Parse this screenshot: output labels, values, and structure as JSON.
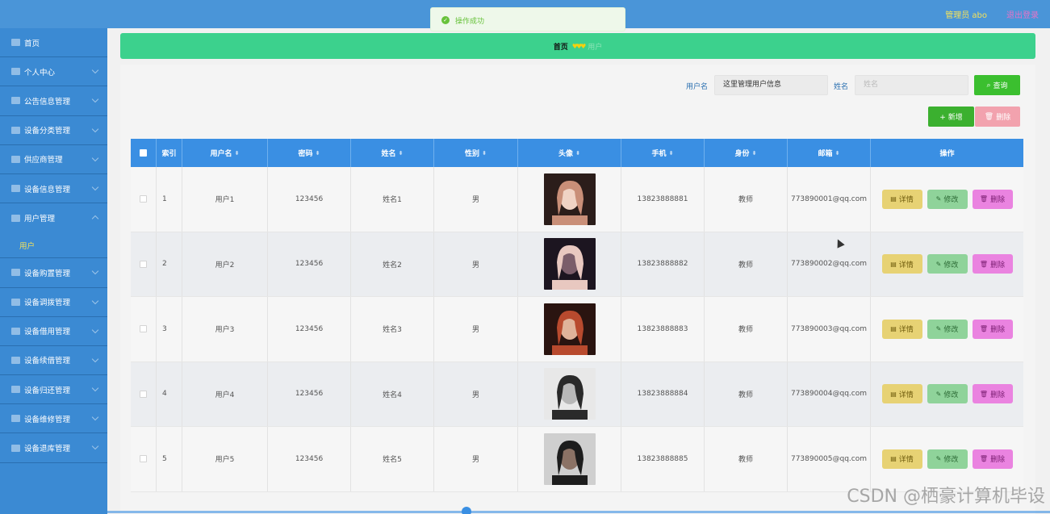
{
  "header": {
    "admin_label": "管理员 abo",
    "logout_label": "退出登录",
    "toast_text": "操作成功",
    "toast_icon": "check-circle-icon"
  },
  "sidebar": {
    "items": [
      {
        "label": "首页",
        "icon": "home-icon"
      },
      {
        "label": "个人中心",
        "icon": "user-icon"
      },
      {
        "label": "公告信息管理",
        "icon": "sliders-icon"
      },
      {
        "label": "设备分类管理",
        "icon": "list-icon"
      },
      {
        "label": "供应商管理",
        "icon": "circle-icon"
      },
      {
        "label": "设备信息管理",
        "icon": "frame-icon"
      },
      {
        "label": "用户管理",
        "icon": "bank-icon",
        "expanded": true,
        "children": [
          "用户"
        ]
      },
      {
        "label": "设备购置管理",
        "icon": "folder-icon"
      },
      {
        "label": "设备调拨管理",
        "icon": "building-icon"
      },
      {
        "label": "设备借用管理",
        "icon": "grid-icon"
      },
      {
        "label": "设备续借管理",
        "icon": "mail-icon"
      },
      {
        "label": "设备归还管理",
        "icon": "chart-icon"
      },
      {
        "label": "设备维修管理",
        "icon": "flag-icon"
      },
      {
        "label": "设备退库管理",
        "icon": "message-icon"
      }
    ]
  },
  "breadcrumb": {
    "home": "首页",
    "current": "用户"
  },
  "search": {
    "username_label": "用户名",
    "username_value": "这里管理用户信息",
    "name_label": "姓名",
    "name_placeholder": "姓名",
    "search_button": "查询",
    "add_button": "+ 新增",
    "delete_button": "删除"
  },
  "table": {
    "columns": [
      "索引",
      "用户名",
      "密码",
      "姓名",
      "性别",
      "头像",
      "手机",
      "身份",
      "邮箱",
      "操作"
    ],
    "rows": [
      {
        "index": "1",
        "username": "用户1",
        "password": "123456",
        "name": "姓名1",
        "gender": "男",
        "phone": "13823888881",
        "role": "教师",
        "email": "773890001@qq.com"
      },
      {
        "index": "2",
        "username": "用户2",
        "password": "123456",
        "name": "姓名2",
        "gender": "男",
        "phone": "13823888882",
        "role": "教师",
        "email": "773890002@qq.com"
      },
      {
        "index": "3",
        "username": "用户3",
        "password": "123456",
        "name": "姓名3",
        "gender": "男",
        "phone": "13823888883",
        "role": "教师",
        "email": "773890003@qq.com"
      },
      {
        "index": "4",
        "username": "用户4",
        "password": "123456",
        "name": "姓名4",
        "gender": "男",
        "phone": "13823888884",
        "role": "教师",
        "email": "773890004@qq.com"
      },
      {
        "index": "5",
        "username": "用户5",
        "password": "123456",
        "name": "姓名5",
        "gender": "男",
        "phone": "13823888885",
        "role": "教师",
        "email": "773890005@qq.com"
      }
    ],
    "actions": {
      "detail": "详情",
      "edit": "修改",
      "delete": "删除"
    }
  },
  "watermark": "CSDN @栖豪计算机毕设",
  "colors": {
    "header_bg": "#4a95d8",
    "sidebar_bg": "#3b8ad3",
    "breadcrumb_bg": "#3cd18d",
    "table_header_bg": "#3a8fe3",
    "detail_btn": "#e7d274",
    "edit_btn": "#8fd39a",
    "delete_btn": "#ea83e0"
  }
}
